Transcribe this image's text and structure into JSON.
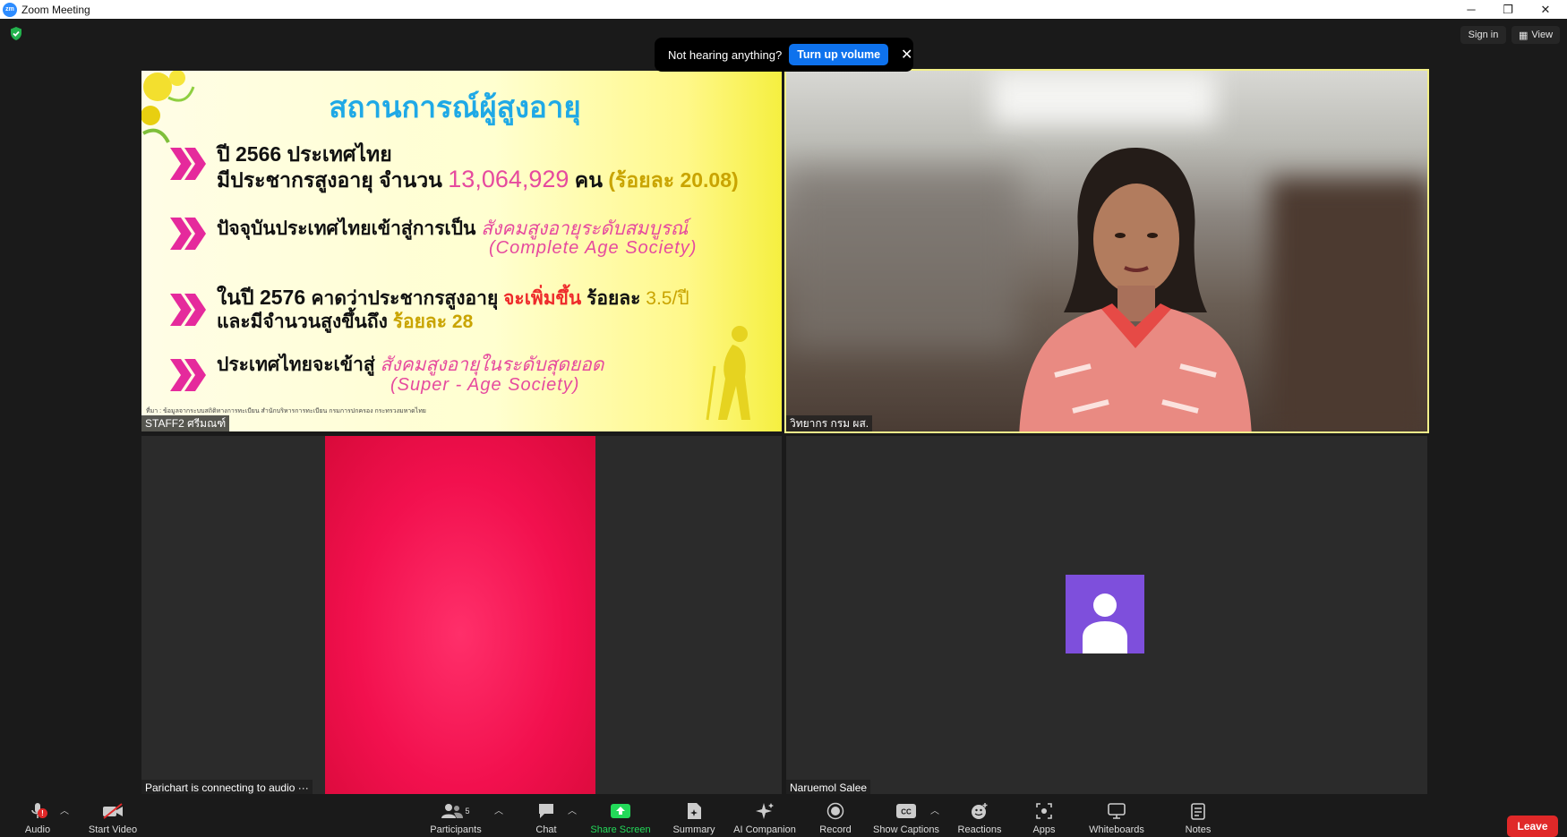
{
  "window": {
    "title": "Zoom Meeting",
    "minimize": "─",
    "restore": "❐",
    "close": "✕"
  },
  "header": {
    "sign_in": "Sign in",
    "view": "View"
  },
  "notice": {
    "text": "Not hearing anything?",
    "action": "Turn up volume",
    "close": "✕"
  },
  "slide": {
    "title": "สถานการณ์ผู้สูงอายุ",
    "b1_line1": "ปี 2566 ประเทศไทย",
    "b1_line2a": "มีประชากรสูงอายุ  จำนวน ",
    "b1_num": "13,064,929",
    "b1_unit": " คน ",
    "b1_pct": "(ร้อยละ 20.08)",
    "b2_line1a": "ปัจจุบันประเทศไทยเข้าสู่การเป็น ",
    "b2_line1b": "สังคมสูงอายุระดับสมบูรณ์",
    "b2_line2": "(Complete Age Society)",
    "b3_line1a": "ในปี 2576 ",
    "b3_line1b": "คาดว่าประชากรสูงอายุ ",
    "b3_line1c": "จะเพิ่มขึ้น",
    "b3_line1d": " ร้อยละ ",
    "b3_line1e": "3.5/ปี",
    "b3_line2a": "และมีจำนวนสูงขึ้นถึง ",
    "b3_line2b": "ร้อยละ 28",
    "b4_line1a": "ประเทศไทยจะเข้าสู่ ",
    "b4_line1b": "สังคมสูงอายุในระดับสุดยอด",
    "b4_line2": "(Super - Age Society)",
    "footnote": "ที่มา : ข้อมูลจากระบบสถิติทางการทะเบียน  สำนักบริหารการทะเบียน  กรมการปกครอง  กระทรวงมหาดไทย"
  },
  "participants": [
    {
      "name": "STAFF2 ศรีมณฑ์"
    },
    {
      "name": "วิทยากร กรม ผส."
    },
    {
      "name": "Parichart is connecting to audio ···"
    },
    {
      "name": "Naruemol Salee"
    }
  ],
  "toolbar": {
    "audio": "Audio",
    "audio_badge": "!",
    "start_video": "Start Video",
    "participants": "Participants",
    "participants_count": "5",
    "chat": "Chat",
    "share_screen": "Share Screen",
    "summary": "Summary",
    "ai_companion": "AI Companion",
    "record": "Record",
    "show_captions": "Show Captions",
    "reactions": "Reactions",
    "apps": "Apps",
    "whiteboards": "Whiteboards",
    "notes": "Notes",
    "leave": "Leave"
  },
  "colors": {
    "accent": "#0e72ed",
    "leave": "#e02828",
    "share": "#23d959",
    "active_speaker": "#f3f08a"
  }
}
